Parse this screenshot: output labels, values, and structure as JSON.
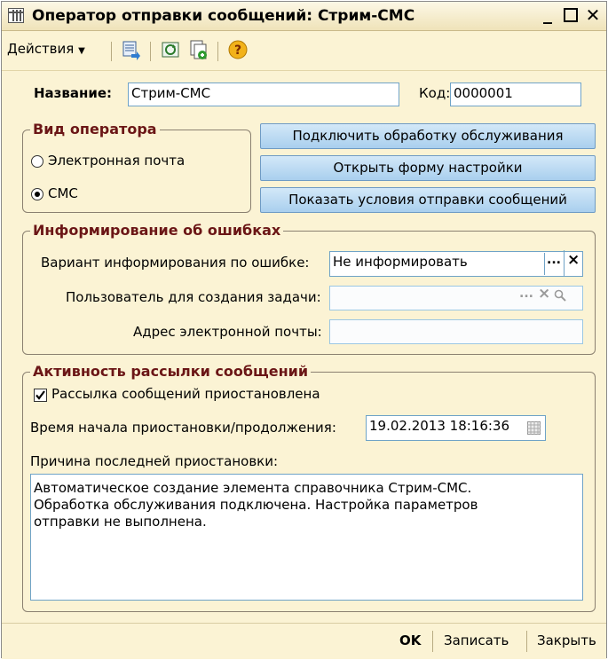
{
  "window": {
    "title": "Оператор отправки сообщений: Стрим-СМС",
    "minimize_icon": "minimize-icon",
    "maximize_icon": "maximize-icon",
    "close_icon": "close-icon"
  },
  "toolbar": {
    "actions_label": "Действия",
    "icons": [
      "export-icon",
      "refresh-icon",
      "copy-icon",
      "help-icon"
    ]
  },
  "form": {
    "name_label": "Название:",
    "name_value": "Стрим-СМС",
    "code_label": "Код:",
    "code_value": "0000001"
  },
  "operator_type": {
    "title": "Вид оператора",
    "option_email": "Электронная почта",
    "option_sms": "СМС",
    "selected": "СМС"
  },
  "buttons": {
    "connect_processing": "Подключить обработку обслуживания",
    "open_settings": "Открыть форму настройки",
    "show_conditions": "Показать условия отправки сообщений"
  },
  "errors": {
    "title": "Информирование об ошибках",
    "variant_label": "Вариант информирования по ошибке:",
    "variant_value": "Не информировать",
    "user_label": "Пользователь для создания задачи:",
    "user_value": "",
    "email_label": "Адрес электронной почты:",
    "email_value": "",
    "ellipsis": "...",
    "clear": "×"
  },
  "activity": {
    "title": "Активность рассылки сообщений",
    "suspended_label": "Рассылка сообщений приостановлена",
    "suspended_checked": true,
    "time_label": "Время начала приостановки/продолжения:",
    "time_value": "19.02.2013 18:16:36",
    "reason_label": "Причина последней приостановки:",
    "reason_text": "Автоматическое создание элемента справочника Стрим-СМС.\nОбработка обслуживания подключена. Настройка параметров\nотправки не выполнена."
  },
  "footer": {
    "ok": "OK",
    "save": "Записать",
    "close": "Закрыть"
  },
  "colors": {
    "background": "#fbf3d4",
    "group_title": "#6b1616",
    "button": "#a9cfee",
    "input_border": "#6fa3c7"
  }
}
